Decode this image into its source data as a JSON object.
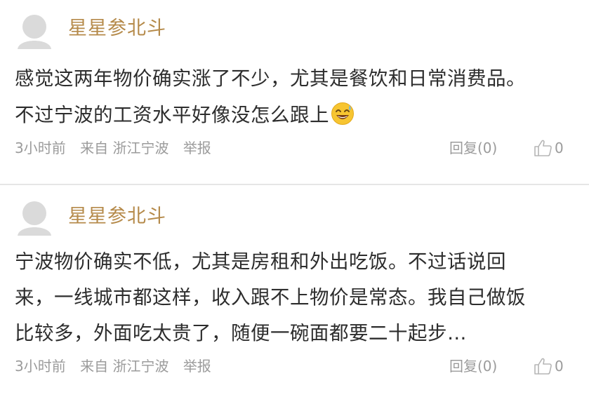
{
  "comments": [
    {
      "username": "星星参北斗",
      "lines": [
        "感觉这两年物价确实涨了不少，尤其是餐饮和日常消费品。",
        "不过宁波的工资水平好像没怎么跟上"
      ],
      "emoji_icon": "sweat-smile-emoji-icon",
      "time": "3小时前",
      "source": "来自 浙江宁波",
      "report": "举报",
      "reply": "回复(0)",
      "likes": "0"
    },
    {
      "username": "星星参北斗",
      "lines": [
        "宁波物价确实不低，尤其是房租和外出吃饭。不过话说回",
        "来，一线城市都这样，收入跟不上物价是常态。我自己做饭",
        "比较多，外面吃太贵了，随便一碗面都要二十起步…"
      ],
      "time": "3小时前",
      "source": "来自 浙江宁波",
      "report": "举报",
      "reply": "回复(0)",
      "likes": "0"
    }
  ],
  "colors": {
    "username": "#b58a4a",
    "text": "#2d2d2d",
    "meta": "#9b9b9b",
    "divider": "#e6e6e6",
    "avatar": "#d9d9d9"
  }
}
